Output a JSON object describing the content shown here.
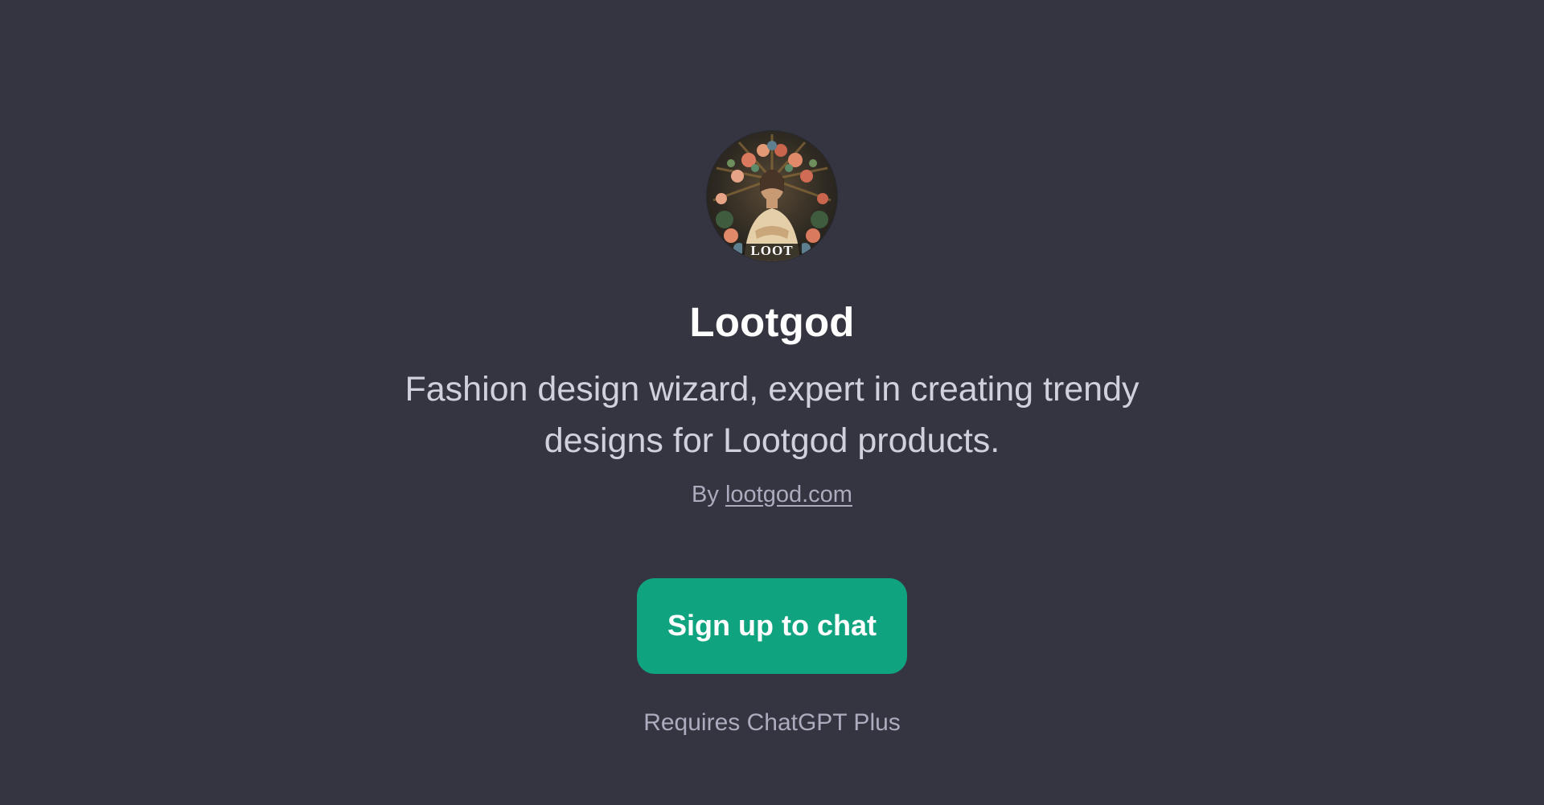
{
  "gpt": {
    "avatar_icon": "lootgod-avatar-icon",
    "avatar_badge_text": "LOOT",
    "name": "Lootgod",
    "description": "Fashion design wizard, expert in creating trendy designs for Lootgod products.",
    "by_prefix": "By",
    "author_link": "lootgod.com"
  },
  "cta": {
    "signup_label": "Sign up to chat",
    "requirement_note": "Requires ChatGPT Plus"
  },
  "colors": {
    "background": "#343541",
    "accent": "#10a37f",
    "title": "#ffffff",
    "description": "#d1d1db",
    "muted": "#acacbe"
  }
}
